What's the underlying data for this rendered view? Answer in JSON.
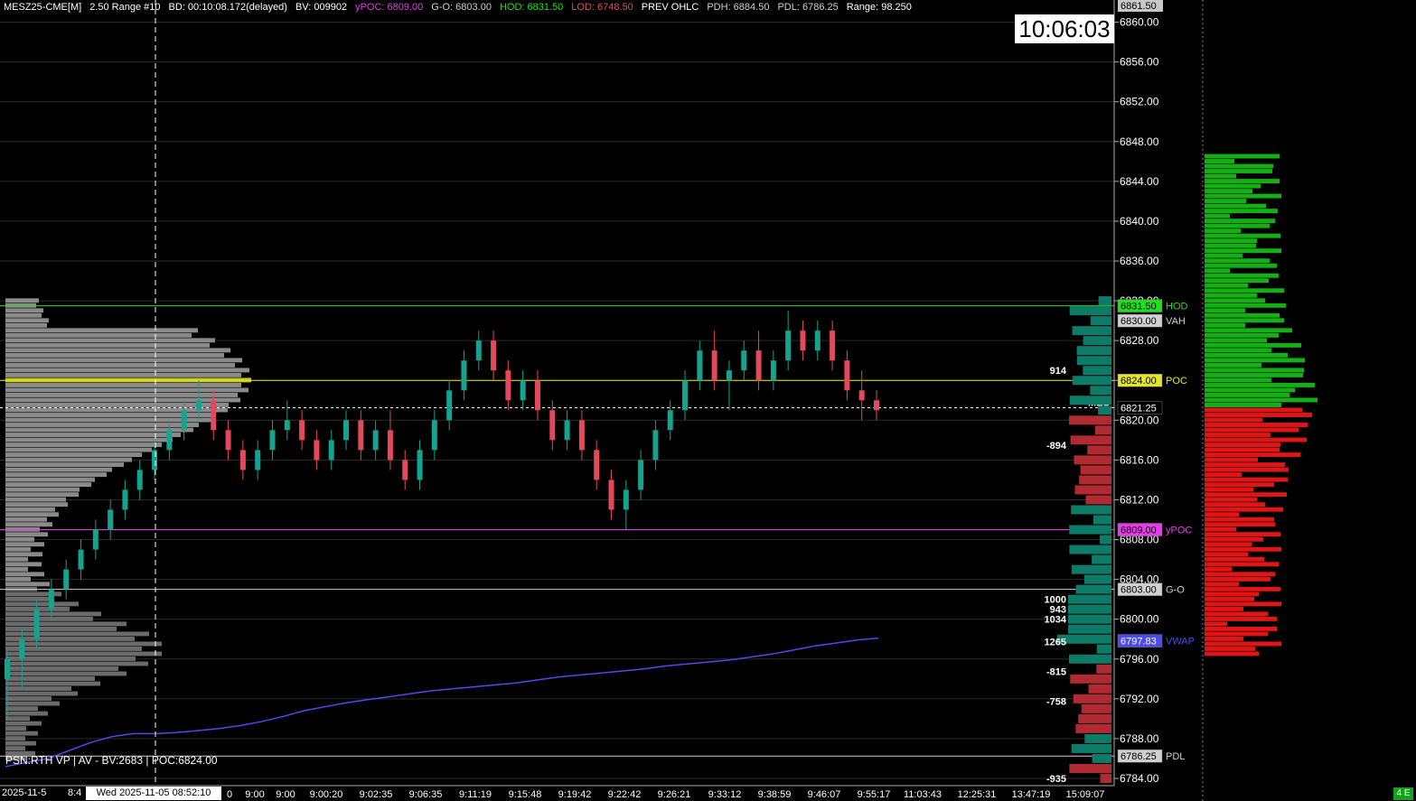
{
  "header": {
    "symbol": "MESZ25-CME[M]",
    "bars": "2.50 Range #10",
    "bd": "BD: 00:10:08.172(delayed)",
    "bv": "BV: 009902",
    "ypoc": "yPOC: 6809.00",
    "go": "G-O: 6803.00",
    "hod": "HOD: 6831.50",
    "lod": "LOD: 6748.50",
    "prev": "PREV OHLC",
    "pdh": "PDH: 6884.50",
    "pdl": "PDL: 6786.25",
    "range": "Range: 98.250"
  },
  "clock": "10:06:03",
  "colors": {
    "bg": "#000000",
    "up": "#13a38e",
    "down": "#e2495a",
    "grid": "#2b2b2b",
    "vwap": "#4a4cf0",
    "hod": "#1ee11e",
    "poc": "#e5e52a",
    "ypoc": "#e63be6",
    "vah": "#d8d8d8",
    "profile_gray": "#8a8a8a",
    "bid": "#13b013",
    "ask": "#e01515",
    "delta_pos": "#0e7a68",
    "delta_neg": "#b02a32"
  },
  "price_axis": {
    "min": 6784,
    "max": 6861.5,
    "ticks": [
      "6860.00",
      "6856.00",
      "6852.00",
      "6848.00",
      "6844.00",
      "6840.00",
      "6836.00",
      "6832.00",
      "6828.00",
      "6824.00",
      "6820.00",
      "6816.00",
      "6812.00",
      "6808.00",
      "6804.00",
      "6800.00",
      "6796.00",
      "6792.00",
      "6788.00",
      "6784.00"
    ],
    "top_label": "6861.50"
  },
  "levels": [
    {
      "name": "HOD",
      "price": 6831.5,
      "label": "6831.50",
      "tag": "HOD",
      "box": "#1ee11e",
      "text": "#000",
      "tagcolor": "#1ee11e",
      "line": "#1ee11e"
    },
    {
      "name": "VAH",
      "price": 6830.0,
      "label": "6830.00",
      "tag": "VAH",
      "box": "#d0d0d0",
      "text": "#000",
      "tagcolor": "#d0d0d0",
      "line": ""
    },
    {
      "name": "POC",
      "price": 6824.0,
      "label": "6824.00",
      "tag": "POC",
      "box": "#e5e52a",
      "text": "#000",
      "tagcolor": "#e5e52a",
      "line": "#e5e52a"
    },
    {
      "name": "MES",
      "price": 6821.25,
      "label": "6821.25",
      "tag": "",
      "box": "#000",
      "text": "#fff",
      "tagcolor": "#fff",
      "line": "dash"
    },
    {
      "name": "yPOC",
      "price": 6809.0,
      "label": "6809.00",
      "tag": "yPOC",
      "box": "#e63be6",
      "text": "#000",
      "tagcolor": "#e63be6",
      "line": "#e63be6"
    },
    {
      "name": "G-O",
      "price": 6803.0,
      "label": "6803.00",
      "tag": "G-O",
      "box": "#d0d0d0",
      "text": "#000",
      "tagcolor": "#d0d0d0",
      "line": "#d0d0d0"
    },
    {
      "name": "VWAP",
      "price": 6797.83,
      "label": "6797.83",
      "tag": "VWAP",
      "box": "#4a4cf0",
      "text": "#fff",
      "tagcolor": "#4a4cf0",
      "line": ""
    },
    {
      "name": "PDL",
      "price": 6786.25,
      "label": "6786.25",
      "tag": "PDL",
      "box": "#d0d0d0",
      "text": "#000",
      "tagcolor": "#d0d0d0",
      "line": "#d0d0d0"
    }
  ],
  "mes_label": "MES",
  "time_axis": {
    "start_date": "2025-11-5",
    "start_partial": "8:4",
    "cursor": "Wed 2025-11-05  08:52:10",
    "labels": [
      "0",
      "9:00",
      "9:00",
      "9:00:20",
      "9:02:35",
      "9:06:35",
      "9:11:19",
      "9:15:48",
      "9:19:42",
      "9:22:42",
      "9:26:21",
      "9:33:12",
      "9:38:59",
      "9:46:07",
      "9:55:17",
      "11:03:43",
      "12:25:31",
      "13:47:19",
      "15:09:07"
    ]
  },
  "psn_text": "PSN:RTH VP | AV - BV:2683 | POC:6824.00",
  "delta_labels": [
    {
      "price": 6825.0,
      "text": "914"
    },
    {
      "price": 6817.5,
      "text": "-894"
    },
    {
      "price": 6802.0,
      "text": "1000"
    },
    {
      "price": 6801.0,
      "text": "943"
    },
    {
      "price": 6800.0,
      "text": "1034"
    },
    {
      "price": 6797.75,
      "text": "1265"
    },
    {
      "price": 6794.75,
      "text": "-815"
    },
    {
      "price": 6791.75,
      "text": "-758"
    },
    {
      "price": 6784.0,
      "text": "-935"
    }
  ],
  "badge": "4 E",
  "chart_data": {
    "type": "candlestick",
    "candles": [
      [
        6794,
        6797,
        6790,
        6796
      ],
      [
        6796,
        6799,
        6793,
        6798
      ],
      [
        6798,
        6802,
        6797,
        6801
      ],
      [
        6801,
        6804,
        6800,
        6803
      ],
      [
        6803,
        6806,
        6802,
        6805
      ],
      [
        6805,
        6808,
        6804,
        6807
      ],
      [
        6807,
        6810,
        6806,
        6809
      ],
      [
        6809,
        6812,
        6808,
        6811
      ],
      [
        6811,
        6814,
        6810,
        6813
      ],
      [
        6813,
        6816,
        6812,
        6815
      ],
      [
        6815,
        6818,
        6814,
        6817
      ],
      [
        6817,
        6820,
        6816,
        6819
      ],
      [
        6819,
        6822,
        6818,
        6821
      ],
      [
        6821,
        6824,
        6820,
        6822
      ],
      [
        6822,
        6823,
        6818,
        6819
      ],
      [
        6819,
        6820,
        6816,
        6817
      ],
      [
        6817,
        6818,
        6814,
        6815
      ],
      [
        6815,
        6818,
        6814,
        6817
      ],
      [
        6817,
        6820,
        6816,
        6819
      ],
      [
        6819,
        6822,
        6818,
        6820
      ],
      [
        6820,
        6821,
        6817,
        6818
      ],
      [
        6818,
        6819,
        6815,
        6816
      ],
      [
        6816,
        6819,
        6815,
        6818
      ],
      [
        6818,
        6821,
        6817,
        6820
      ],
      [
        6820,
        6821,
        6816,
        6817
      ],
      [
        6817,
        6820,
        6816,
        6819
      ],
      [
        6819,
        6821,
        6815,
        6816
      ],
      [
        6816,
        6817,
        6813,
        6814
      ],
      [
        6814,
        6818,
        6813,
        6817
      ],
      [
        6817,
        6821,
        6816,
        6820
      ],
      [
        6820,
        6824,
        6819,
        6823
      ],
      [
        6823,
        6827,
        6822,
        6826
      ],
      [
        6826,
        6829,
        6825,
        6828
      ],
      [
        6828,
        6829,
        6824,
        6825
      ],
      [
        6825,
        6826,
        6821,
        6822
      ],
      [
        6822,
        6825,
        6821,
        6824
      ],
      [
        6824,
        6825,
        6820,
        6821
      ],
      [
        6821,
        6822,
        6817,
        6818
      ],
      [
        6818,
        6821,
        6817,
        6820
      ],
      [
        6820,
        6821,
        6816,
        6817
      ],
      [
        6817,
        6818,
        6813,
        6814
      ],
      [
        6814,
        6815,
        6810,
        6811
      ],
      [
        6811,
        6814,
        6809,
        6813
      ],
      [
        6813,
        6817,
        6812,
        6816
      ],
      [
        6816,
        6820,
        6815,
        6819
      ],
      [
        6819,
        6822,
        6818,
        6821
      ],
      [
        6821,
        6825,
        6820,
        6824
      ],
      [
        6824,
        6828,
        6823,
        6827
      ],
      [
        6827,
        6829,
        6823,
        6824
      ],
      [
        6824,
        6826,
        6821,
        6825
      ],
      [
        6825,
        6828,
        6824,
        6827
      ],
      [
        6827,
        6829,
        6823,
        6824
      ],
      [
        6824,
        6827,
        6823,
        6826
      ],
      [
        6826,
        6831,
        6825,
        6829
      ],
      [
        6829,
        6830,
        6826,
        6827
      ],
      [
        6827,
        6830,
        6826,
        6829
      ],
      [
        6829,
        6830,
        6825,
        6826
      ],
      [
        6826,
        6827,
        6822,
        6823
      ],
      [
        6823,
        6825,
        6820,
        6822
      ],
      [
        6822,
        6823,
        6820,
        6821
      ]
    ],
    "vwap": [
      6785.2,
      6785.6,
      6786.0,
      6786.8,
      6787.6,
      6788.2,
      6788.5,
      6788.5,
      6788.6,
      6788.8,
      6789.0,
      6789.3,
      6789.7,
      6790.2,
      6790.8,
      6791.2,
      6791.6,
      6791.9,
      6792.2,
      6792.5,
      6792.8,
      6793.0,
      6793.2,
      6793.4,
      6793.6,
      6793.9,
      6794.2,
      6794.4,
      6794.6,
      6794.8,
      6795.0,
      6795.3,
      6795.5,
      6795.7,
      6795.9,
      6796.2,
      6796.5,
      6796.9,
      6797.3,
      6797.6,
      6797.9,
      6798.1
    ],
    "volume_profile": {
      "from": 6786,
      "to": 6832,
      "step": 0.5
    },
    "bid_ask_ladder": {
      "from": 6796.5,
      "to": 6846.5,
      "step": 0.5,
      "split": 6821.5
    },
    "delta_bars": {
      "from": 6784,
      "to": 6832,
      "step": 1
    }
  }
}
